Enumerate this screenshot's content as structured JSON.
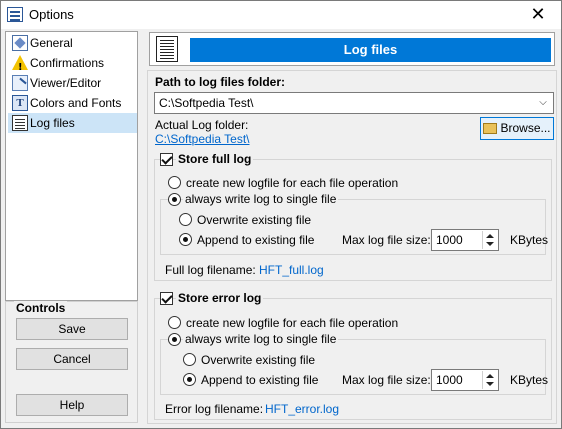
{
  "window": {
    "title": "Options"
  },
  "nav": {
    "items": [
      {
        "label": "General"
      },
      {
        "label": "Confirmations"
      },
      {
        "label": "Viewer/Editor"
      },
      {
        "label": "Colors and Fonts"
      },
      {
        "label": "Log files",
        "selected": true
      }
    ]
  },
  "controls": {
    "title": "Controls",
    "save_label": "Save",
    "cancel_label": "Cancel",
    "help_label": "Help"
  },
  "header": {
    "title": "Log files"
  },
  "path": {
    "label": "Path to log files folder:",
    "value": "C:\\Softpedia Test\\",
    "actual_label": "Actual Log folder:",
    "actual_value": "C:\\Softpedia Test\\",
    "browse_label": "Browse..."
  },
  "full_log": {
    "title": "Store full log",
    "checked": true,
    "opt_new": "create new logfile for each file operation",
    "opt_single": "always write log to single file",
    "opt_overwrite": "Overwrite existing file",
    "opt_append": "Append to existing file",
    "max_label": "Max log file size:",
    "max_value": "1000",
    "unit": "KBytes",
    "filename_label": "Full log filename:",
    "filename": "HFT_full.log"
  },
  "error_log": {
    "title": "Store error log",
    "checked": true,
    "opt_new": "create new logfile for each file operation",
    "opt_single": "always write log to single file",
    "opt_overwrite": "Overwrite existing file",
    "opt_append": "Append to existing file",
    "max_label": "Max log file size:",
    "max_value": "1000",
    "unit": "KBytes",
    "filename_label": "Error log filename:",
    "filename": "HFT_error.log"
  },
  "colors": {
    "accent": "#0078d7",
    "selection": "#cce4f7",
    "link": "#0066cc"
  }
}
